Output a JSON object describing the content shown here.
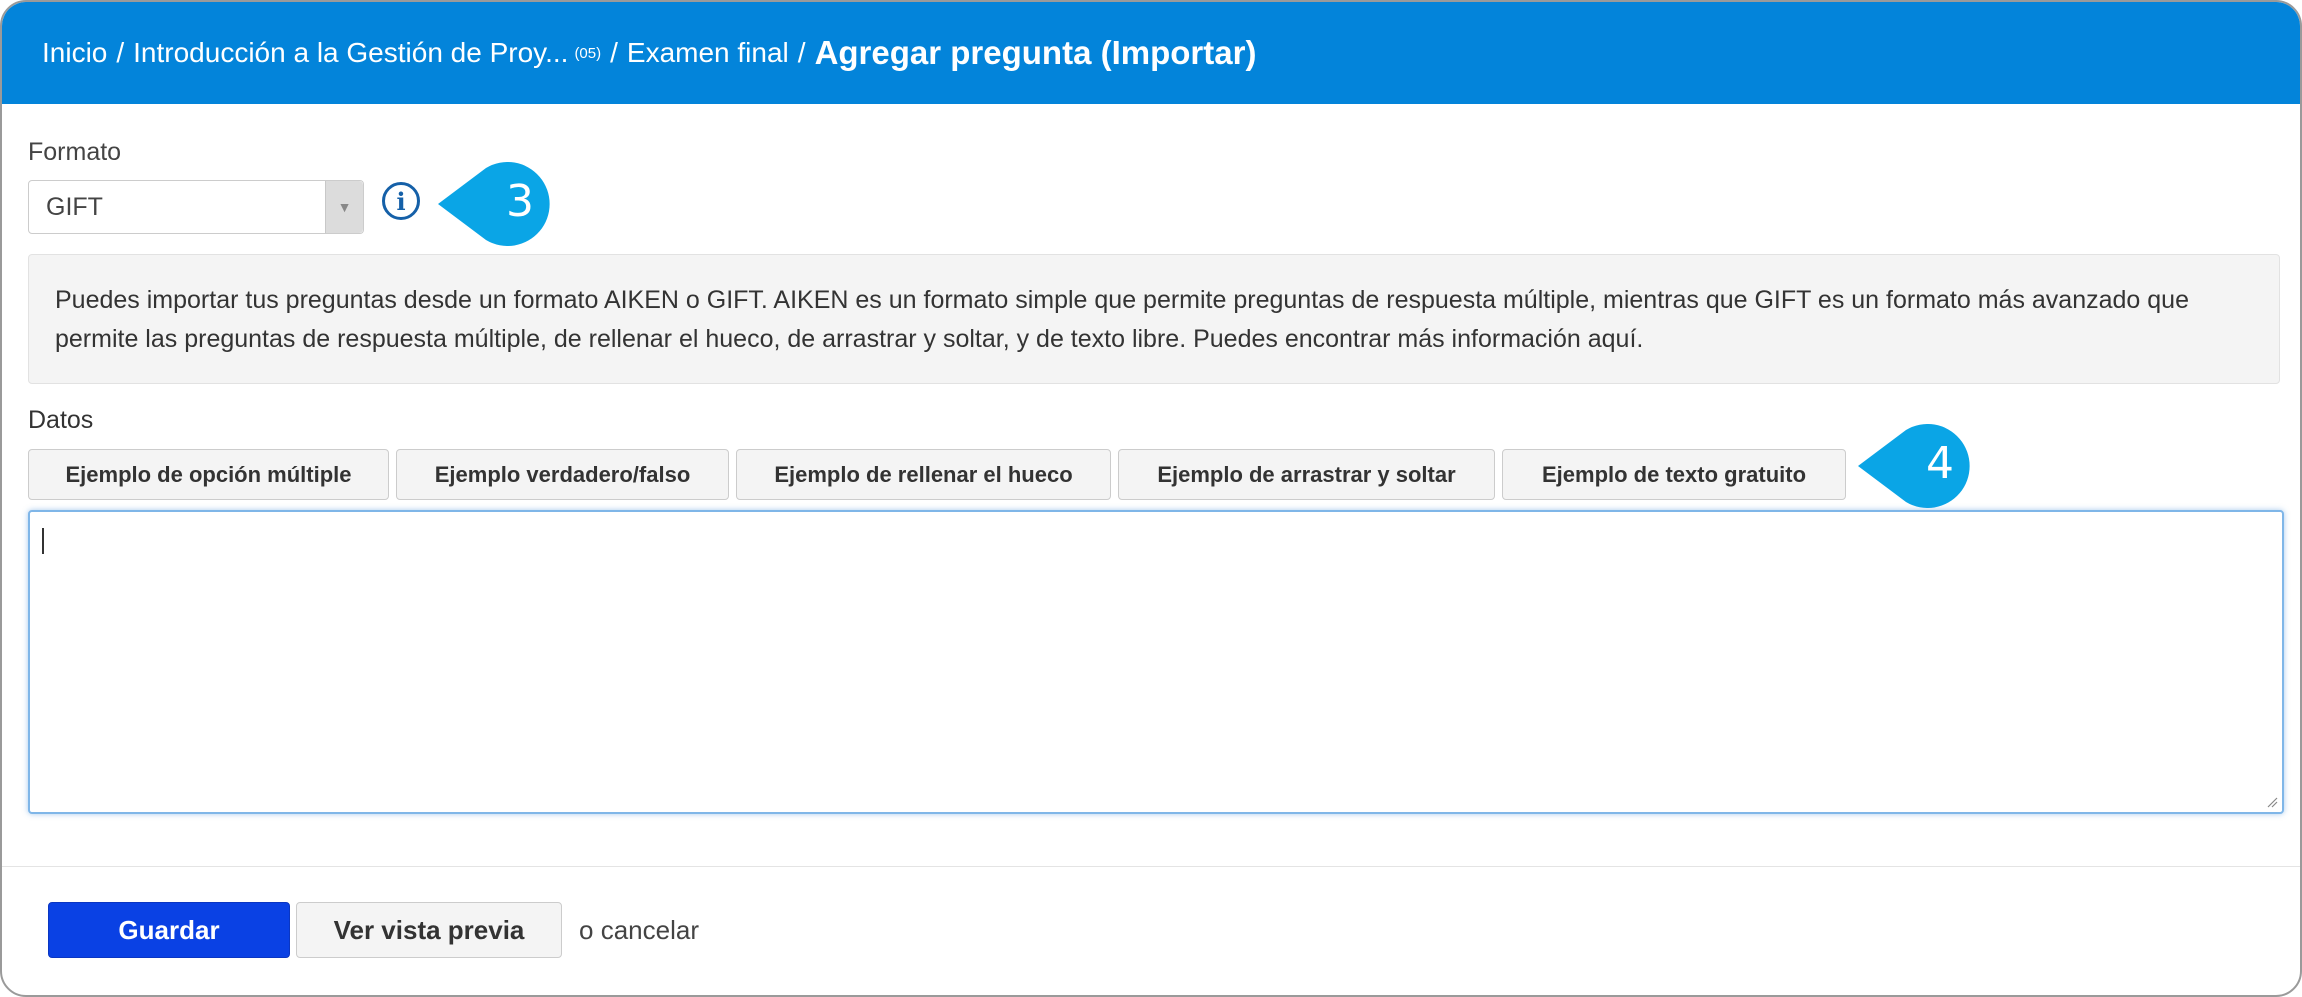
{
  "header": {
    "breadcrumb_home": "Inicio",
    "breadcrumb_course": "Introducción a la Gestión de Proy...",
    "breadcrumb_course_count": "(05)",
    "breadcrumb_exam": "Examen final",
    "separator": "/",
    "page_title": "Agregar pregunta (Importar)"
  },
  "format": {
    "label": "Formato",
    "selected": "GIFT",
    "info_icon": "info-circle-icon",
    "callout_number": "3"
  },
  "description": "Puedes importar tus preguntas desde un formato AIKEN o GIFT. AIKEN es un formato simple que permite preguntas de respuesta múltiple, mientras que GIFT es un formato más avanzado que permite las preguntas de respuesta múltiple, de rellenar el hueco, de arrastrar y soltar, y de texto libre. Puedes encontrar más información aquí.",
  "data_section": {
    "label": "Datos",
    "examples": [
      "Ejemplo de opción múltiple",
      "Ejemplo verdadero/falso",
      "Ejemplo de rellenar el hueco",
      "Ejemplo de arrastrar y soltar",
      "Ejemplo de texto gratuito"
    ],
    "callout_number": "4",
    "textarea_value": ""
  },
  "footer": {
    "save_label": "Guardar",
    "preview_label": "Ver vista previa",
    "cancel_prefix": "o",
    "cancel_label": "cancelar"
  },
  "colors": {
    "header_bg": "#0384da",
    "callout": "#0aa5e6",
    "save_button": "#0a41e4"
  }
}
